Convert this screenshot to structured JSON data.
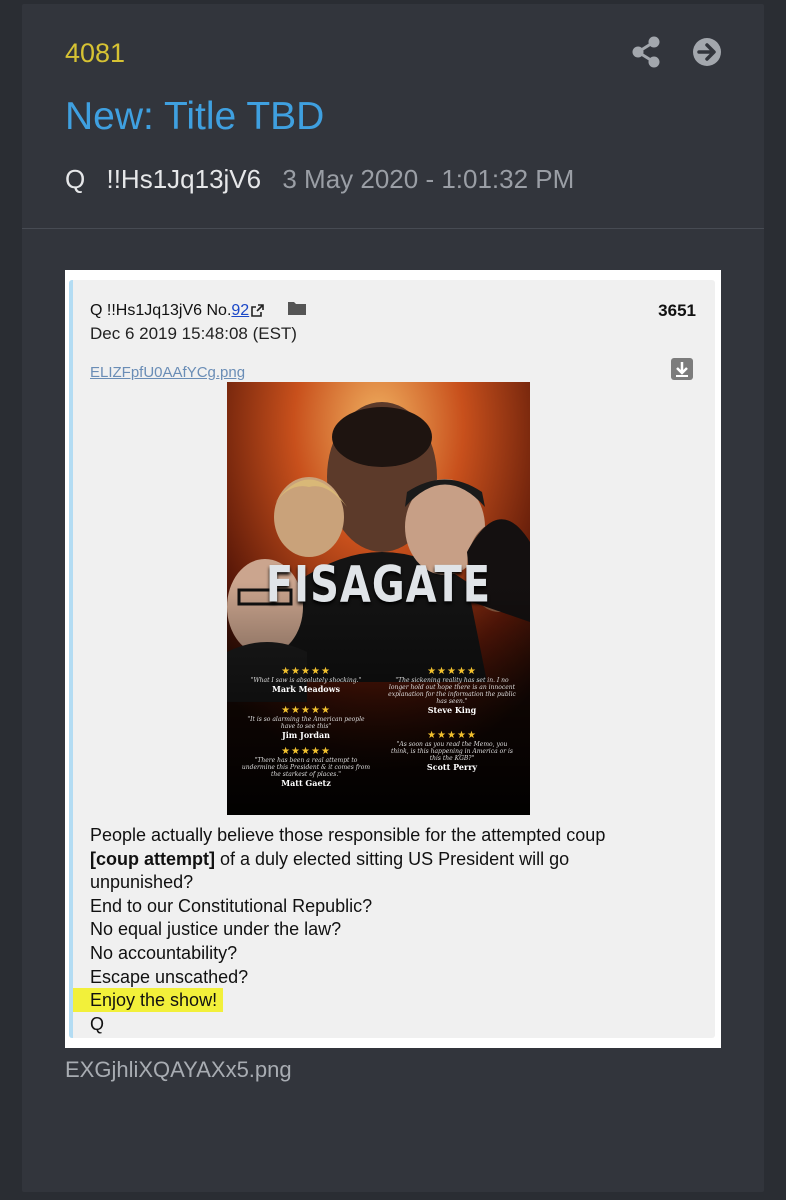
{
  "post": {
    "number": "4081",
    "title": "New: Title TBD",
    "author": "Q",
    "tripcode": "!!Hs1Jq13jV6",
    "date": "3 May 2020 - 1:01:32 PM",
    "share_icon": "share-icon",
    "open_icon": "arrow-right-circle-icon"
  },
  "embedded": {
    "header": "Q !!Hs1Jq13jV6 No.",
    "board_num": "92",
    "post_id": "3651",
    "timestamp": "Dec 6 2019 15:48:08 (EST)",
    "filename": "ELIZFpfU0AAfYCg.png",
    "poster": {
      "title": "FISAGATE",
      "reviews": [
        {
          "stars": "★★★★★",
          "quote": "\"What I saw is absolutely shocking.\"",
          "name": "Mark Meadows"
        },
        {
          "stars": "★★★★★",
          "quote": "\"It is so alarming the American people have to see this\"",
          "name": "Jim Jordan"
        },
        {
          "stars": "★★★★★",
          "quote": "\"There has been a real attempt to undermine this President & it comes from the starkest of places.\"",
          "name": "Matt Gaetz"
        },
        {
          "stars": "★★★★★",
          "quote": "\"The sickening reality has set in. I no longer hold out hope there is an innocent explanation for the information the public has seen.\"",
          "name": "Steve King"
        },
        {
          "stars": "★★★★★",
          "quote": "\"As soon as you read the Memo, you think, is this happening in America or is this the KGB?\"",
          "name": "Scott Perry"
        }
      ]
    },
    "lines": {
      "l1": "People actually believe those responsible for the attempted coup",
      "l2_bold": "[coup attempt]",
      "l2_rest": " of a duly elected sitting US President will go",
      "l3": "unpunished?",
      "l4": "End to our Constitutional Republic?",
      "l5": "No equal justice under the law?",
      "l6": "No accountability?",
      "l7": "Escape unscathed?",
      "l8": "Enjoy the show!",
      "l9": "Q"
    },
    "highlight_color": "#f2f03a"
  },
  "caption": "EXGjhliXQAYAXx5.png",
  "colors": {
    "number": "#d6c233",
    "title": "#3fa0e0",
    "card": "#32353c",
    "background": "#2a2d33"
  }
}
